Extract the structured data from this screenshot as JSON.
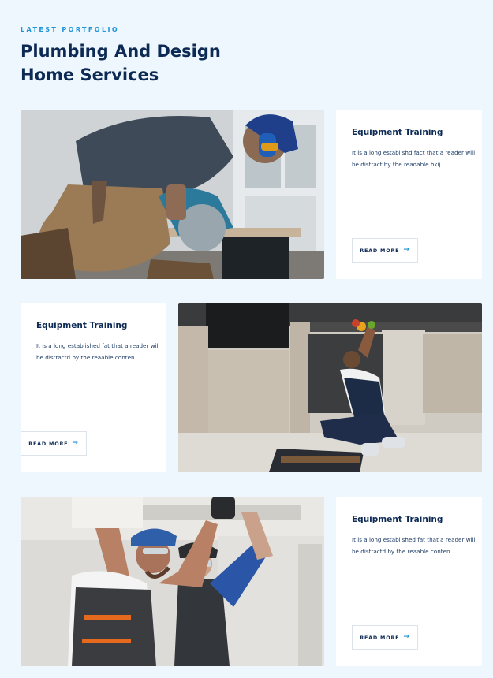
{
  "section": {
    "eyebrow": "LATEST PORTFOLIO",
    "title_line1": "Plumbing And Design",
    "title_line2": "Home Services"
  },
  "colors": {
    "accent": "#1f94d6",
    "heading": "#0d2a54",
    "background": "#eef7fd",
    "card": "#ffffff"
  },
  "portfolio": [
    {
      "image": "worker cutting wood with circular saw",
      "title": "Equipment Training",
      "text": "It is a long establishd fact that a reader will be distract by the readable hkij",
      "button": "READ MORE",
      "button_icon": "arrow-right-icon"
    },
    {
      "image": "plumber repairing kitchen sink",
      "title": "Equipment Training",
      "text": "It is a long established fat that a reader will be distractd by the reaable  conten",
      "button": "READ MORE",
      "button_icon": "arrow-right-icon"
    },
    {
      "image": "two workers installing ceiling fixture",
      "title": "Equipment Training",
      "text": "It is a long established fat that a reader will be distractd by the reaable  conten",
      "button": "READ MORE",
      "button_icon": "arrow-right-icon"
    }
  ]
}
